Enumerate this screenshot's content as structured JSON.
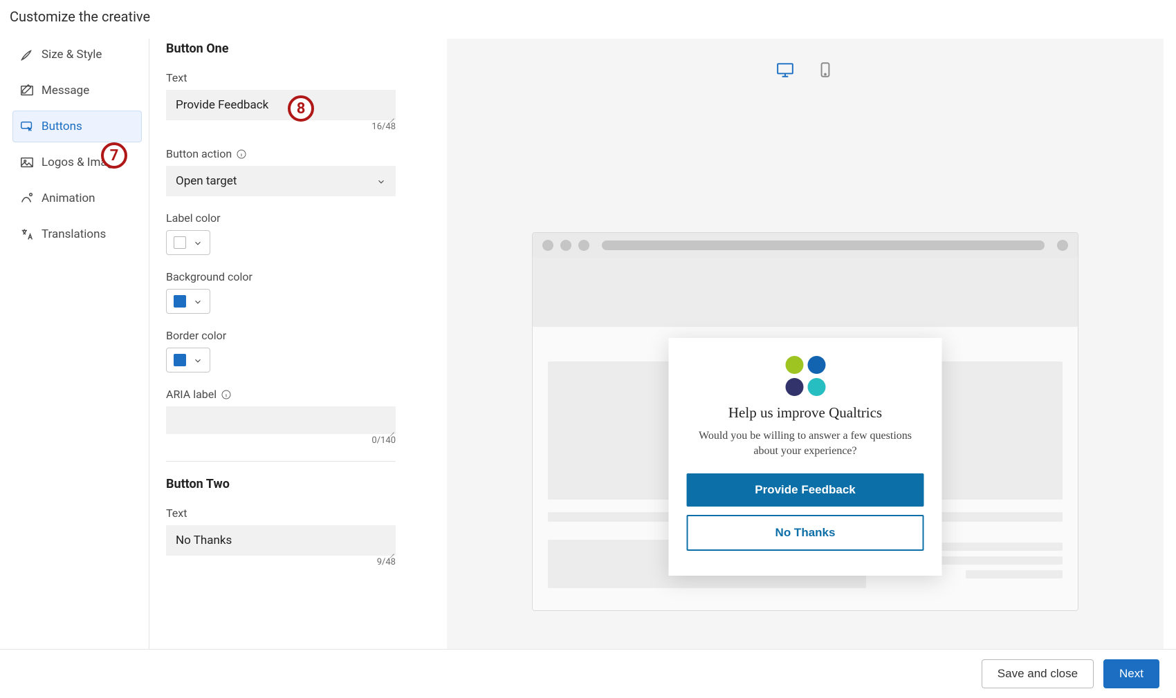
{
  "header": {
    "title": "Customize the creative"
  },
  "sidebar": {
    "items": [
      {
        "label": "Size & Style"
      },
      {
        "label": "Message"
      },
      {
        "label": "Buttons"
      },
      {
        "label": "Logos & Imag..."
      },
      {
        "label": "Animation"
      },
      {
        "label": "Translations"
      }
    ],
    "activeIndex": 2
  },
  "panel": {
    "section1": {
      "heading": "Button One",
      "text_label": "Text",
      "text_value": "Provide Feedback",
      "text_count": "16/48",
      "action_label": "Button action",
      "action_value": "Open target",
      "label_color_label": "Label color",
      "label_color_value": "#ffffff",
      "bg_color_label": "Background color",
      "bg_color_value": "#1b6ec2",
      "border_color_label": "Border color",
      "border_color_value": "#1b6ec2",
      "aria_label": "ARIA label",
      "aria_value": "",
      "aria_count": "0/140"
    },
    "section2": {
      "heading": "Button Two",
      "text_label": "Text",
      "text_value": "No Thanks",
      "text_count": "9/48"
    }
  },
  "preview": {
    "modal_title": "Help us improve Qualtrics",
    "modal_subtitle": "Would you be willing to answer a few questions about your experience?",
    "primary_btn": "Provide Feedback",
    "secondary_btn": "No Thanks",
    "logo_colors": [
      "#9ec421",
      "#1364b0",
      "#32336a",
      "#27bec2"
    ]
  },
  "annotations": {
    "a7": "7",
    "a8": "8"
  },
  "footer": {
    "save": "Save and close",
    "next": "Next"
  }
}
